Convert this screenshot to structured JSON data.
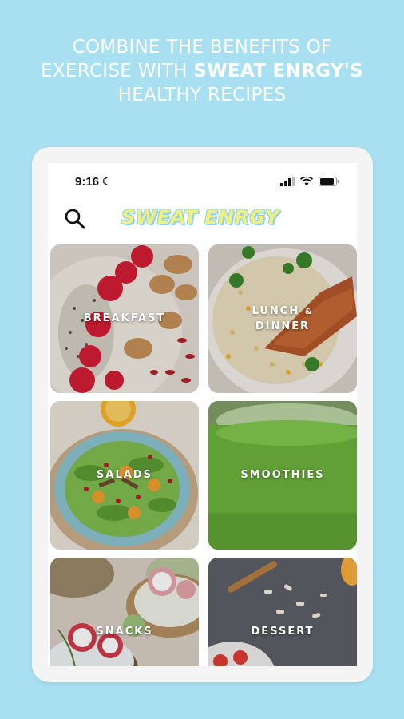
{
  "headline": {
    "line1": "COMBINE THE BENEFITS OF",
    "line2_plain": "EXERCISE WITH ",
    "line2_bold": "SWEAT ENRGY'S",
    "line3": "HEALTHY RECIPES"
  },
  "status_bar": {
    "time": "9:16"
  },
  "app": {
    "logo": "SWEAT ENRGY"
  },
  "categories": [
    {
      "label": "BREAKFAST"
    },
    {
      "label_top": "LUNCH",
      "amp": "&",
      "label_bottom": "DINNER"
    },
    {
      "label": "SALADS"
    },
    {
      "label": "SMOOTHIES"
    },
    {
      "label": "SNACKS"
    },
    {
      "label": "DESSERT"
    }
  ],
  "colors": {
    "background": "#a8e0f1",
    "logo_fill": "#f2f07d",
    "logo_outline": "#8fd3ea"
  }
}
